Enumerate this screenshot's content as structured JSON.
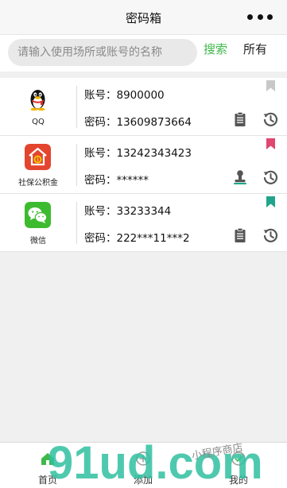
{
  "header": {
    "title": "密码箱"
  },
  "search": {
    "placeholder": "请输入使用场所或账号的名称",
    "value": "",
    "search_label": "搜索",
    "all_label": "所有"
  },
  "colors": {
    "accent": "#3fb84a",
    "bookmark_gray": "#c8c8c8",
    "bookmark_red": "#e0466e",
    "bookmark_teal": "#1fa68a"
  },
  "items": [
    {
      "app_name": "QQ",
      "icon": "qq-penguin-icon",
      "account_label": "账号：",
      "account": "8900000",
      "password_label": "密码：",
      "password": "13609873664",
      "action": "clipboard-icon",
      "bookmark": "gray"
    },
    {
      "app_name": "社保公积金",
      "icon": "house-fund-icon",
      "account_label": "账号：",
      "account": "13242343423",
      "password_label": "密码：",
      "password": "******",
      "action": "stamp-icon",
      "bookmark": "red"
    },
    {
      "app_name": "微信",
      "icon": "wechat-icon",
      "account_label": "账号：",
      "account": "33233344",
      "password_label": "密码：",
      "password": "222***11***2",
      "action": "clipboard-icon",
      "bookmark": "teal"
    }
  ],
  "tabs": [
    {
      "label": "首页",
      "icon": "home-icon"
    },
    {
      "label": "添加",
      "icon": "add-icon"
    },
    {
      "label": "我的",
      "icon": "profile-icon"
    }
  ],
  "watermark": {
    "text": "91ud.com",
    "tagline": "小程序商店"
  }
}
